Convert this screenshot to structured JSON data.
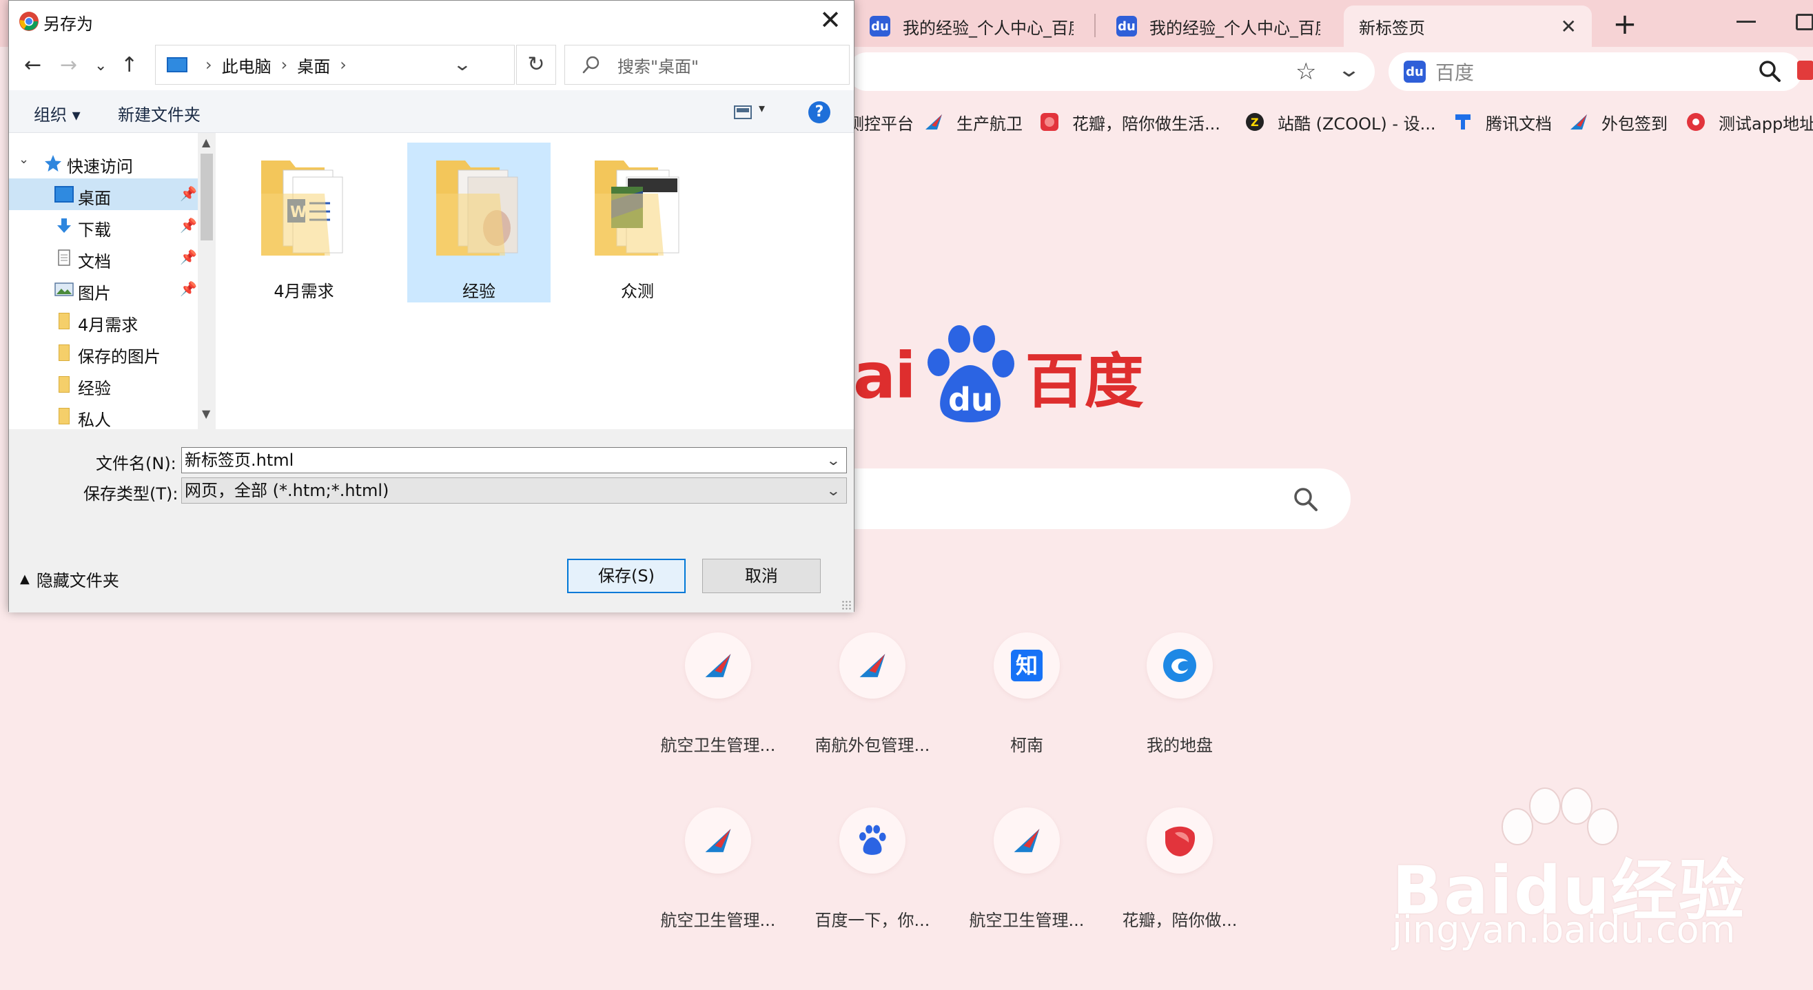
{
  "browser": {
    "tabs": [
      {
        "label": "我的经验_个人中心_百度经验",
        "active": false
      },
      {
        "label": "我的经验_个人中心_百度经验",
        "active": false
      },
      {
        "label": "新标签页",
        "active": true
      }
    ],
    "tab_close": "✕",
    "new_tab": "+",
    "search_placeholder": "百度",
    "bookmarks": [
      {
        "label": "测控平台",
        "icon": "monitor-icon"
      },
      {
        "label": "生产航卫",
        "icon": "airline-icon"
      },
      {
        "label": "花瓣，陪你做生活...",
        "icon": "huaban-icon"
      },
      {
        "label": "站酷 (ZCOOL) - 设...",
        "icon": "zcool-icon"
      },
      {
        "label": "腾讯文档",
        "icon": "tencent-docs-icon"
      },
      {
        "label": "外包签到",
        "icon": "airline-icon"
      },
      {
        "label": "测试app地址",
        "icon": "app-icon"
      }
    ]
  },
  "page": {
    "logo_latin": "ai",
    "logo_du": "du",
    "logo_cn": "百度",
    "quick_links": [
      {
        "label": "航空卫生管理...",
        "icon": "airline-icon"
      },
      {
        "label": "南航外包管理...",
        "icon": "airline-icon"
      },
      {
        "label": "柯南",
        "icon": "zhihu-icon"
      },
      {
        "label": "我的地盘",
        "icon": "wodedipan-icon"
      },
      {
        "label": "航空卫生管理...",
        "icon": "airline-icon"
      },
      {
        "label": "百度一下，你...",
        "icon": "baidu-icon"
      },
      {
        "label": "航空卫生管理...",
        "icon": "airline-icon"
      },
      {
        "label": "花瓣，陪你做...",
        "icon": "huaban-icon"
      }
    ],
    "zhihu_glyph": "知",
    "watermark_text": "Baidu经验",
    "watermark_url": "jingyan.baidu.com"
  },
  "dialog": {
    "title": "另存为",
    "close": "✕",
    "path": [
      "此电脑",
      "桌面"
    ],
    "search_placeholder": "搜索\"桌面\"",
    "organize": "组织 ▾",
    "new_folder": "新建文件夹",
    "help": "?",
    "tree": [
      {
        "label": "快速访问",
        "icon": "star-icon",
        "level": 0
      },
      {
        "label": "桌面",
        "icon": "desktop-icon",
        "pinned": true,
        "selected": true
      },
      {
        "label": "下载",
        "icon": "download-icon",
        "pinned": true
      },
      {
        "label": "文档",
        "icon": "document-icon",
        "pinned": true
      },
      {
        "label": "图片",
        "icon": "pictures-icon",
        "pinned": true
      },
      {
        "label": "4月需求",
        "icon": "folder-icon"
      },
      {
        "label": "保存的图片",
        "icon": "folder-icon"
      },
      {
        "label": "经验",
        "icon": "folder-icon"
      },
      {
        "label": "私人",
        "icon": "folder-icon"
      }
    ],
    "pin_glyph": "📌",
    "files": [
      {
        "name": "4月需求",
        "selected": false
      },
      {
        "name": "经验",
        "selected": true
      },
      {
        "name": "众测",
        "selected": false
      }
    ],
    "filename_label": "文件名(N):",
    "filename_value": "新标签页.html",
    "filetype_label": "保存类型(T):",
    "filetype_value": "网页，全部 (*.htm;*.html)",
    "hide_folders": "隐藏文件夹",
    "save_button": "保存(S)",
    "cancel_button": "取消"
  }
}
